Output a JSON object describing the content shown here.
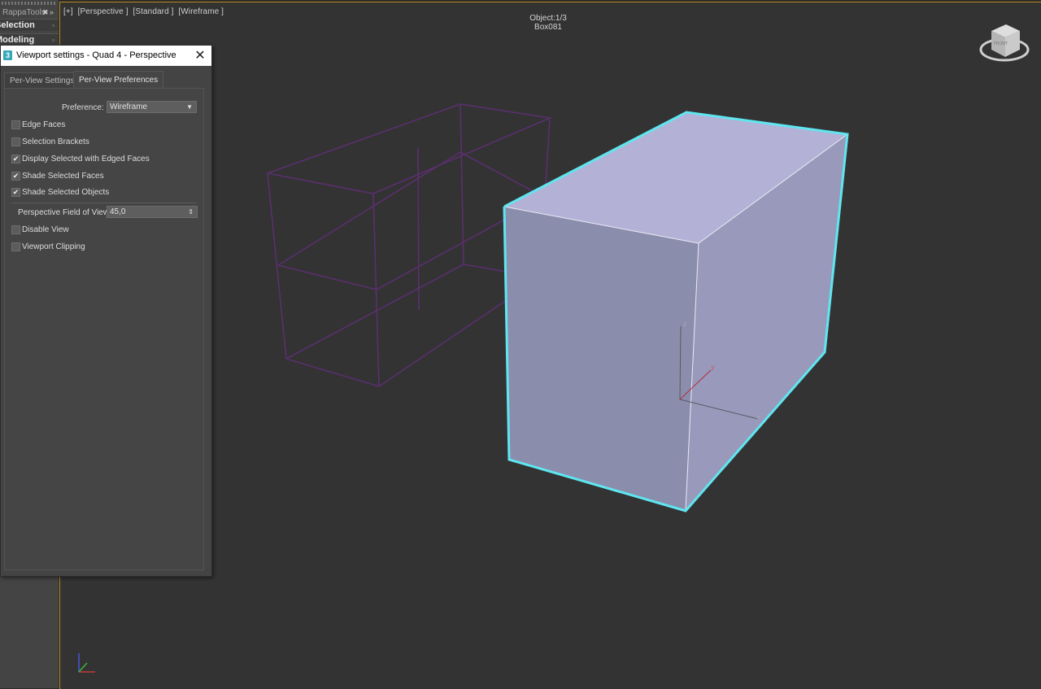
{
  "left_panel": {
    "toolbar_label": "RappaTools",
    "close_glyph": "✖",
    "arrow_glyph": "»",
    "rollouts": [
      "Selection",
      "Modeling"
    ]
  },
  "viewport": {
    "labels": [
      "[+]",
      "[Perspective ]",
      "[Standard ]",
      "[Wireframe ]"
    ],
    "object_count": "Object:1/3",
    "object_name": "Box081",
    "active_border_color": "#b88a1a",
    "selection_color": "#5fe6f0",
    "unselected_wire_color": "#5a2f6e",
    "gizmo_axes": {
      "z": "z",
      "y": "y",
      "x": "x"
    },
    "viewcube": {
      "face": "FRONT"
    }
  },
  "dialog": {
    "title": "Viewport settings - Quad 4 - Perspective",
    "close_glyph": "✕",
    "app_icon": "3",
    "tabs": [
      {
        "label": "Per-View Settings",
        "active": false
      },
      {
        "label": "Per-View Preferences",
        "active": true
      }
    ],
    "preference_label": "Preference:",
    "preference_value": "Wireframe",
    "checkboxes_top": [
      {
        "label": "Edge Faces",
        "checked": false
      },
      {
        "label": "Selection Brackets",
        "checked": false
      },
      {
        "label": "Display Selected with Edged Faces",
        "checked": true
      },
      {
        "label": "Shade Selected Faces",
        "checked": true
      },
      {
        "label": "Shade Selected Objects",
        "checked": true
      }
    ],
    "fov_label": "Perspective Field of View:",
    "fov_value": "45,0",
    "checkboxes_bottom": [
      {
        "label": "Disable View",
        "checked": false
      },
      {
        "label": "Viewport Clipping",
        "checked": false
      }
    ]
  }
}
